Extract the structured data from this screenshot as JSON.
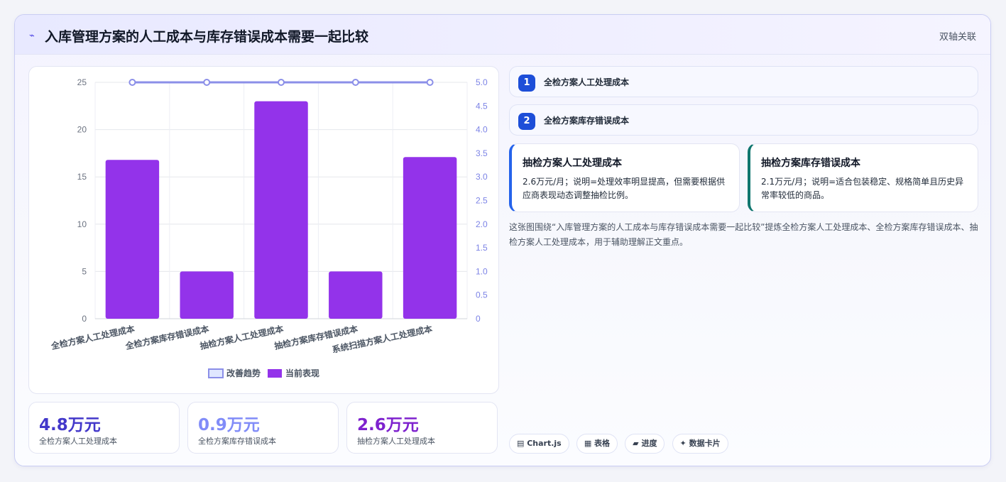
{
  "header": {
    "icon": "trend-icon",
    "title": "入库管理方案的人工成本与库存错误成本需要一起比较",
    "tag": "双轴关联"
  },
  "chart_data": {
    "type": "bar",
    "categories": [
      "全检方案人工处理成本",
      "全检方案库存错误成本",
      "抽检方案人工处理成本",
      "抽检方案库存错误成本",
      "系统扫描方案人工处理成本"
    ],
    "series": [
      {
        "name": "改善趋势",
        "type": "line",
        "axis": "right",
        "values": [
          5.0,
          5.0,
          5.0,
          5.0,
          5.0
        ],
        "color": "#8b8fe8"
      },
      {
        "name": "当前表现",
        "type": "bar",
        "axis": "left",
        "values": [
          16.8,
          5.0,
          23.0,
          5.0,
          17.1
        ],
        "color": "#9333ea"
      }
    ],
    "y_left": {
      "ylim": [
        0,
        25
      ],
      "ticks": [
        "0",
        "5",
        "10",
        "15",
        "20",
        "25"
      ]
    },
    "y_right": {
      "ylim": [
        0,
        5
      ],
      "ticks": [
        "0",
        "0.5",
        "1.0",
        "1.5",
        "2.0",
        "2.5",
        "3.0",
        "3.5",
        "4.0",
        "4.5",
        "5.0"
      ]
    },
    "grid": true,
    "legend_position": "bottom"
  },
  "kpis": [
    {
      "value": "4.8万元",
      "label": "全检方案人工处理成本",
      "color": "#4338ca"
    },
    {
      "value": "0.9万元",
      "label": "全检方案库存错误成本",
      "color": "#818cf8"
    },
    {
      "value": "2.6万元",
      "label": "抽检方案人工处理成本",
      "color": "#7e22ce"
    }
  ],
  "steps": [
    {
      "num": "1",
      "label": "全检方案人工处理成本"
    },
    {
      "num": "2",
      "label": "全检方案库存错误成本"
    }
  ],
  "notes": [
    {
      "title": "抽检方案人工处理成本",
      "body": "2.6万元/月；说明=处理效率明显提高，但需要根据供应商表现动态调整抽检比例。",
      "accent": "#2563eb"
    },
    {
      "title": "抽检方案库存错误成本",
      "body": "2.1万元/月；说明=适合包装稳定、规格简单且历史异常率较低的商品。",
      "accent": "#0f766e"
    }
  ],
  "summary": "这张图围绕“入库管理方案的人工成本与库存错误成本需要一起比较”提炼全检方案人工处理成本、全检方案库存错误成本、抽检方案人工处理成本，用于辅助理解正文重点。",
  "pills": [
    "▤ Chart.js",
    "▦ 表格",
    "▰ 进度",
    "✦ 数据卡片"
  ]
}
